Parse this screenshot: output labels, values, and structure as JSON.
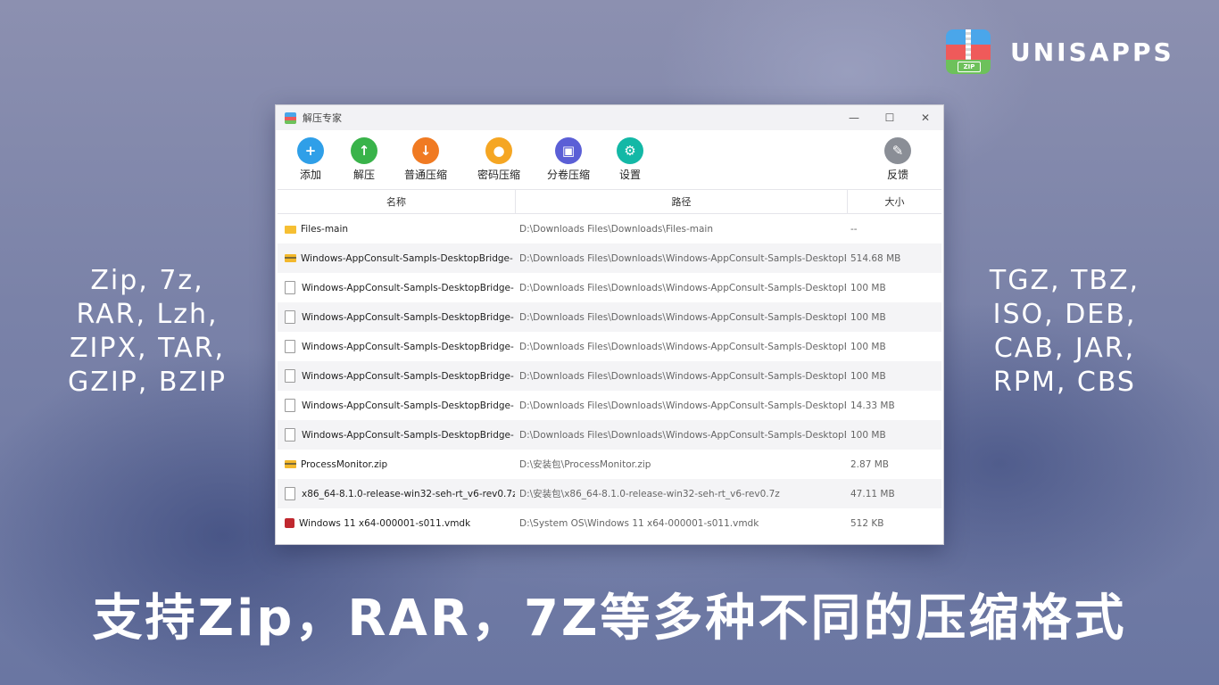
{
  "brand": {
    "name": "UNISAPPS",
    "logo_text": "ZIP"
  },
  "formats_left": [
    "Zip, 7z,",
    "RAR, Lzh,",
    "ZIPX, TAR,",
    "GZIP, BZIP"
  ],
  "formats_right": [
    "TGZ, TBZ,",
    "ISO, DEB,",
    "CAB, JAR,",
    "RPM, CBS"
  ],
  "caption": "支持Zip，RAR，7Z等多种不同的压缩格式",
  "window": {
    "title": "解压专家",
    "controls": {
      "minimize": "—",
      "maximize": "☐",
      "close": "✕"
    }
  },
  "toolbar": {
    "add": "添加",
    "extract": "解压",
    "compress": "普通压缩",
    "password_compress": "密码压缩",
    "split_compress": "分卷压缩",
    "settings": "设置",
    "feedback": "反馈"
  },
  "table": {
    "headers": {
      "name": "名称",
      "path": "路径",
      "size": "大小"
    },
    "rows": [
      {
        "icon": "folder",
        "name": "Files-main",
        "path": "D:\\Downloads Files\\Downloads\\Files-main",
        "size": "--"
      },
      {
        "icon": "archive",
        "name": "Windows-AppConsult-Sampls-DesktopBridge-",
        "path": "D:\\Downloads Files\\Downloads\\Windows-AppConsult-Sampls-DesktopB",
        "size": "514.68 MB"
      },
      {
        "icon": "file",
        "name": "Windows-AppConsult-Sampls-DesktopBridge-",
        "path": "D:\\Downloads Files\\Downloads\\Windows-AppConsult-Sampls-DesktopB",
        "size": "100 MB"
      },
      {
        "icon": "file",
        "name": "Windows-AppConsult-Sampls-DesktopBridge-",
        "path": "D:\\Downloads Files\\Downloads\\Windows-AppConsult-Sampls-DesktopB",
        "size": "100 MB"
      },
      {
        "icon": "file",
        "name": "Windows-AppConsult-Sampls-DesktopBridge-",
        "path": "D:\\Downloads Files\\Downloads\\Windows-AppConsult-Sampls-DesktopB",
        "size": "100 MB"
      },
      {
        "icon": "file",
        "name": "Windows-AppConsult-Sampls-DesktopBridge-",
        "path": "D:\\Downloads Files\\Downloads\\Windows-AppConsult-Sampls-DesktopB",
        "size": "100 MB"
      },
      {
        "icon": "file",
        "name": "Windows-AppConsult-Sampls-DesktopBridge-",
        "path": "D:\\Downloads Files\\Downloads\\Windows-AppConsult-Sampls-DesktopB",
        "size": "14.33 MB"
      },
      {
        "icon": "file",
        "name": "Windows-AppConsult-Sampls-DesktopBridge-",
        "path": "D:\\Downloads Files\\Downloads\\Windows-AppConsult-Sampls-DesktopB",
        "size": "100 MB"
      },
      {
        "icon": "archive",
        "name": "ProcessMonitor.zip",
        "path": "D:\\安装包\\ProcessMonitor.zip",
        "size": "2.87 MB"
      },
      {
        "icon": "file",
        "name": "x86_64-8.1.0-release-win32-seh-rt_v6-rev0.7z",
        "path": "D:\\安装包\\x86_64-8.1.0-release-win32-seh-rt_v6-rev0.7z",
        "size": "47.11 MB"
      },
      {
        "icon": "disk",
        "name": "Windows 11 x64-000001-s011.vmdk",
        "path": "D:\\System OS\\Windows 11 x64-000001-s011.vmdk",
        "size": "512 KB"
      }
    ]
  },
  "colors": {
    "add": "#2f9fe8",
    "extract": "#39b34a",
    "compress": "#f07a22",
    "password_compress": "#f5a623",
    "split_compress": "#5b5fd6",
    "settings": "#13b8a6",
    "feedback": "#8a8e96"
  }
}
